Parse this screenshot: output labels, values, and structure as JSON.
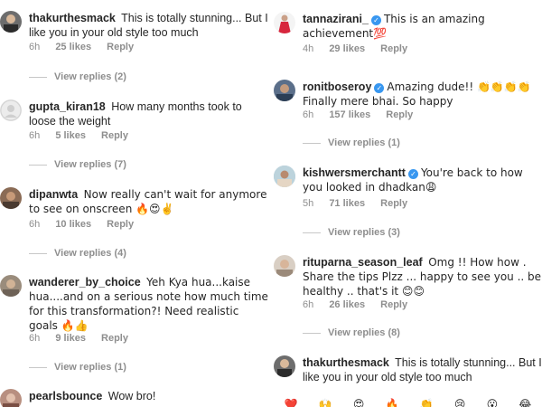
{
  "left": {
    "comments": [
      {
        "user": "thakurthesmack",
        "text": "This is totally stunning... But I like you in your old style too much",
        "time": "6h",
        "likes": "25 likes",
        "reply": "Reply",
        "view_replies": "View replies (2)"
      },
      {
        "user": "gupta_kiran18",
        "text": "How many months took to loose the weight",
        "time": "6h",
        "likes": "5 likes",
        "reply": "Reply",
        "view_replies": "View replies (7)"
      },
      {
        "user": "dipanwta",
        "text": "Now really can't wait for anymore to see on onscreen 🔥😍✌️",
        "time": "6h",
        "likes": "10 likes",
        "reply": "Reply",
        "view_replies": "View replies (4)"
      },
      {
        "user": "wanderer_by_choice",
        "text": "Yeh Kya hua...kaise hua....and on a serious note how much time for this transformation?! Need realistic goals 🔥👍",
        "time": "6h",
        "likes": "9 likes",
        "reply": "Reply",
        "view_replies": "View replies (1)"
      },
      {
        "user": "pearlsbounce",
        "text": "Wow bro!"
      }
    ]
  },
  "right": {
    "comments": [
      {
        "user": "tannazirani_",
        "text": "This is an amazing achievement💯",
        "time": "4h",
        "likes": "29 likes",
        "reply": "Reply"
      },
      {
        "user": "ronitboseroy",
        "text": "Amazing dude!! 👏👏👏👏 Finally mere bhai. So happy",
        "time": "6h",
        "likes": "157 likes",
        "reply": "Reply",
        "view_replies": "View replies (1)"
      },
      {
        "user": "kishwersmerchantt",
        "text": "You're back to how you looked in dhadkan😩",
        "time": "5h",
        "likes": "71 likes",
        "reply": "Reply",
        "view_replies": "View replies (3)"
      },
      {
        "user": "rituparna_season_leaf",
        "text": "Omg !! How how . Share the tips Plzz ... happy to see you .. be healthy .. that's it 😊😊",
        "time": "6h",
        "likes": "26 likes",
        "reply": "Reply",
        "view_replies": "View replies (8)"
      },
      {
        "user": "thakurthesmack",
        "text": "This is totally stunning... But I like you in your old style too much"
      }
    ],
    "emoji_bar": [
      "❤️",
      "🙌",
      "😍",
      "🔥",
      "👏",
      "😢",
      "😮",
      "😂"
    ]
  },
  "colors": {
    "verified": "#3897f0",
    "meta": "#8e8e8e",
    "text": "#262626"
  }
}
